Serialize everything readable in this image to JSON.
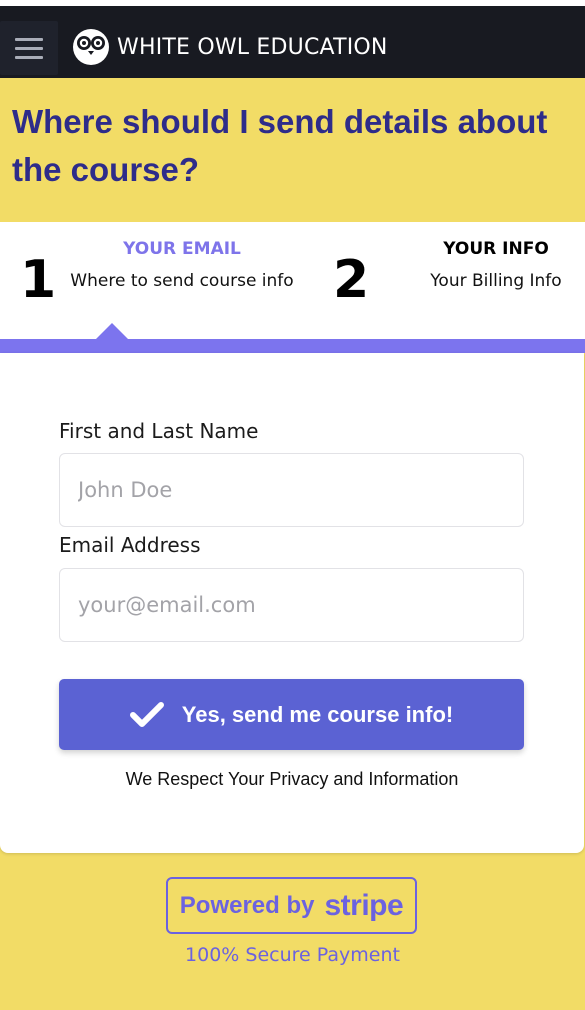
{
  "navbar": {
    "brand": "WHITE OWL EDUCATION",
    "menu_icon": "hamburger-menu-icon",
    "logo_icon": "owl-logo-icon",
    "background": "#181a21"
  },
  "headline": "Where should I send details about the course?",
  "steps": [
    {
      "number": "1",
      "title": "YOUR EMAIL",
      "subtitle": "Where to send course info",
      "active": true
    },
    {
      "number": "2",
      "title": "YOUR INFO",
      "subtitle": "Your Billing Info",
      "active": false
    }
  ],
  "form": {
    "name_label": "First and Last Name",
    "name_placeholder": "John Doe",
    "name_value": "",
    "email_label": "Email Address",
    "email_placeholder": "your@email.com",
    "email_value": "",
    "submit_label": "Yes, send me course info!",
    "submit_icon": "checkmark-icon",
    "privacy_text": "We Respect Your Privacy and Information"
  },
  "footer": {
    "powered_by": "Powered by",
    "stripe": "stripe",
    "secure_text": "100% Secure Payment"
  },
  "colors": {
    "page_background": "#f2dc66",
    "headline": "#2e2c8a",
    "accent": "#7c74ee",
    "button": "#5b62d3",
    "stripe": "#6b62e0"
  }
}
